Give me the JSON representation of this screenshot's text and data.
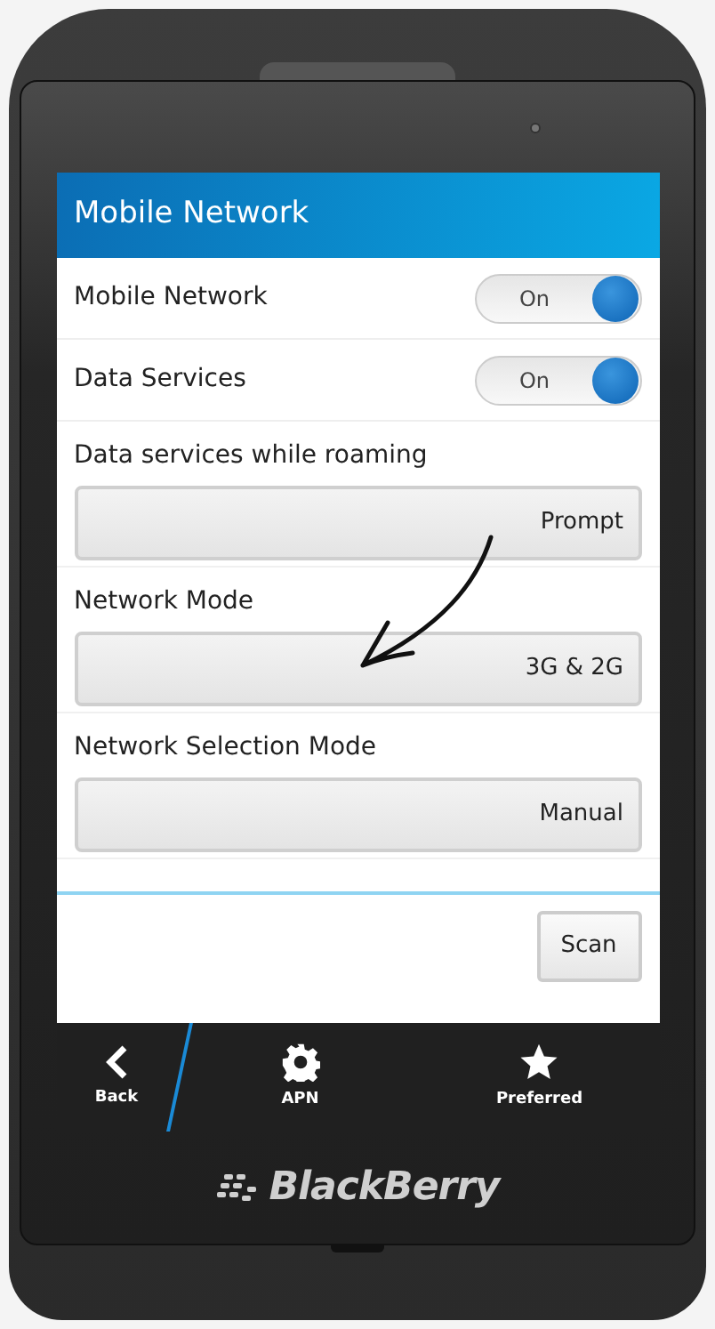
{
  "screen": {
    "title": "Mobile Network"
  },
  "toggles": [
    {
      "label": "Mobile Network",
      "state_text": "On",
      "on": true
    },
    {
      "label": "Data Services",
      "state_text": "On",
      "on": true
    }
  ],
  "dropdowns": [
    {
      "label": "Data services while roaming",
      "value": "Prompt"
    },
    {
      "label": "Network Mode",
      "value": "3G & 2G"
    },
    {
      "label": "Network Selection Mode",
      "value": "Manual"
    }
  ],
  "scan_button": "Scan",
  "action_bar": [
    {
      "kind": "back",
      "label": "Back"
    },
    {
      "kind": "gear",
      "label": "APN"
    },
    {
      "kind": "star",
      "label": "Preferred"
    }
  ],
  "brand": "BlackBerry"
}
